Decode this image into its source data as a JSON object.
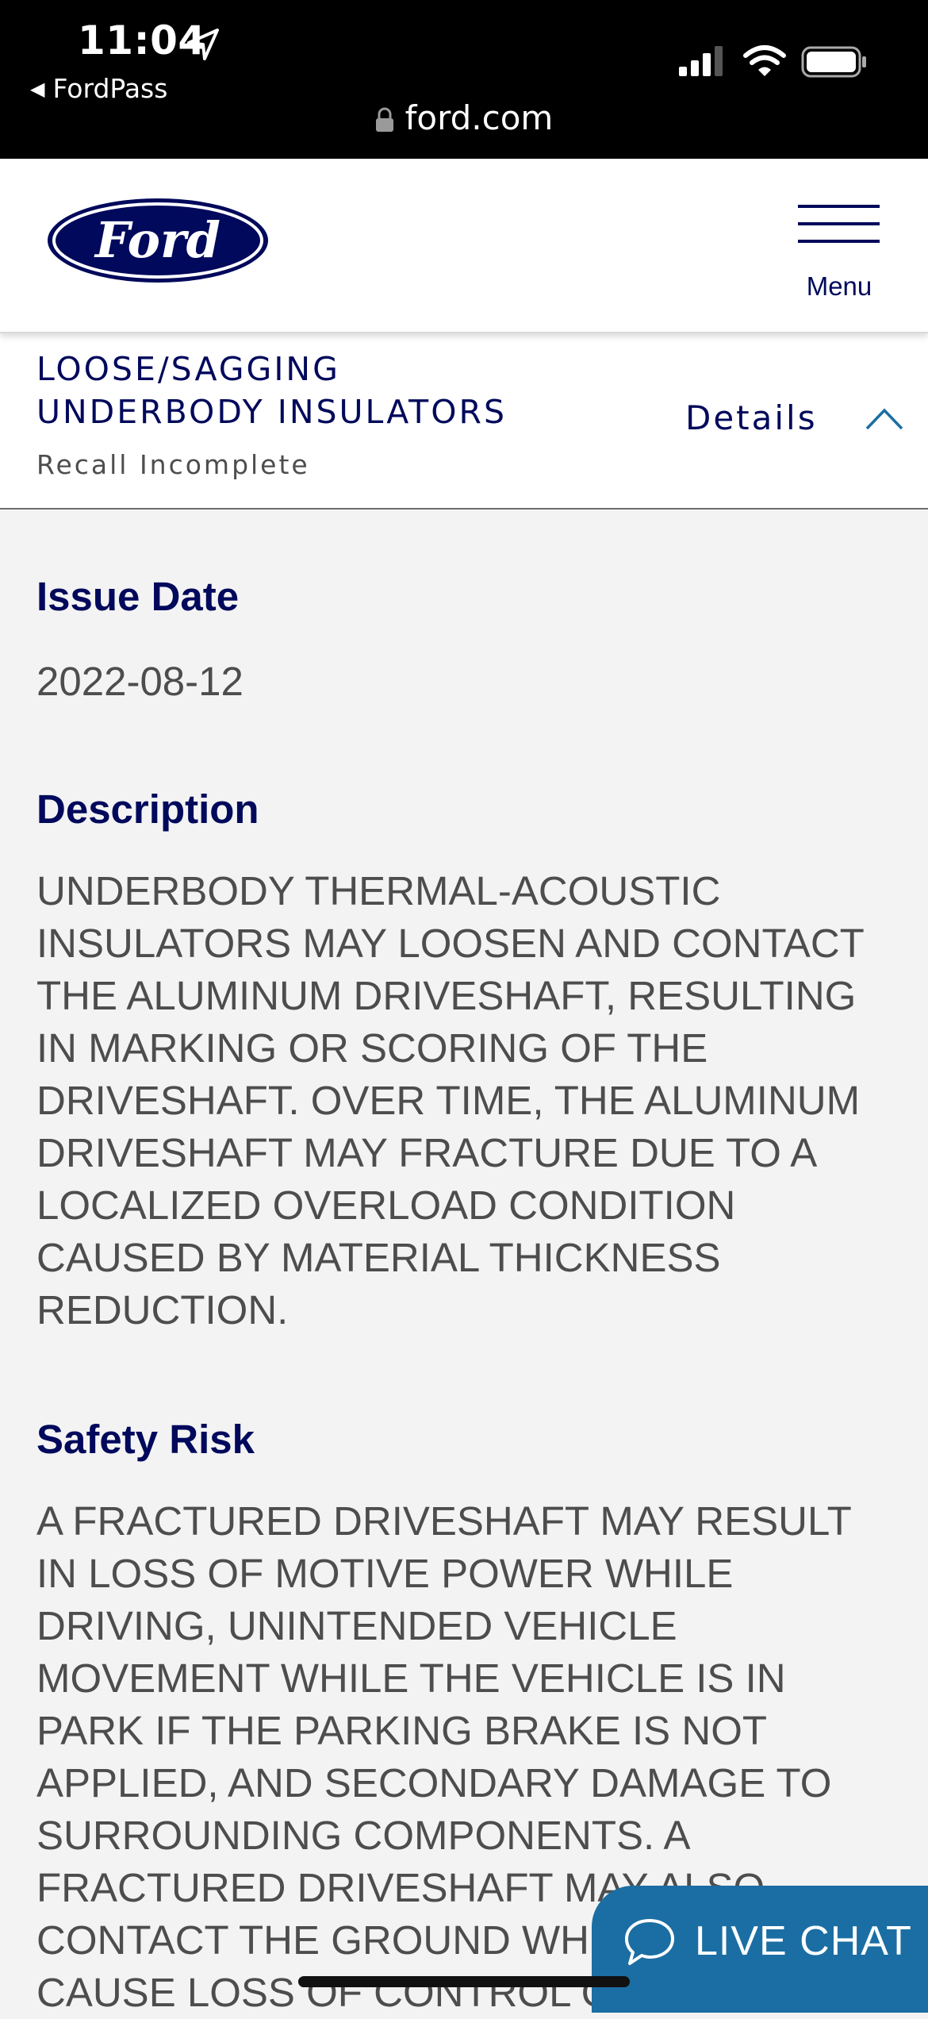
{
  "status_bar": {
    "time": "11:04",
    "back_app": "FordPass",
    "url": "ford.com"
  },
  "header": {
    "logo_text": "Ford",
    "menu_label": "Menu"
  },
  "recall": {
    "title": "LOOSE/SAGGING UNDERBODY INSULATORS",
    "status": "Recall Incomplete",
    "details_label": "Details",
    "details_expanded": true
  },
  "sections": {
    "issue_date_title": "Issue Date",
    "issue_date_value": "2022-08-12",
    "description_title": "Description",
    "description_body": "UNDERBODY THERMAL-ACOUSTIC INSULATORS MAY LOOSEN AND CONTACT THE ALUMINUM DRIVESHAFT, RESULTING IN MARKING OR SCORING OF THE DRIVESHAFT. OVER TIME, THE ALUMINUM DRIVESHAFT MAY FRACTURE DUE TO A LOCALIZED OVERLOAD CONDITION CAUSED BY MATERIAL THICKNESS REDUCTION.",
    "safety_title": "Safety Risk",
    "safety_body": "A FRACTURED DRIVESHAFT MAY RESULT IN LOSS OF MOTIVE POWER WHILE DRIVING, UNINTENDED VEHICLE MOVEMENT WHILE THE VEHICLE IS IN PARK IF THE PARKING BRAKE IS NOT APPLIED, AND SECONDARY DAMAGE TO SURROUNDING COMPONENTS. A FRACTURED DRIVESHAFT MAY ALSO CONTACT THE GROUND WHICH MAY CAUSE LOSS OF CONTROL OF THE"
  },
  "live_chat": {
    "label": "LIVE CHAT"
  },
  "colors": {
    "ford_blue": "#00095b",
    "chat_blue": "#1b6ea3",
    "body_text": "#4d4d4d",
    "page_bg": "#f3f3f3"
  }
}
